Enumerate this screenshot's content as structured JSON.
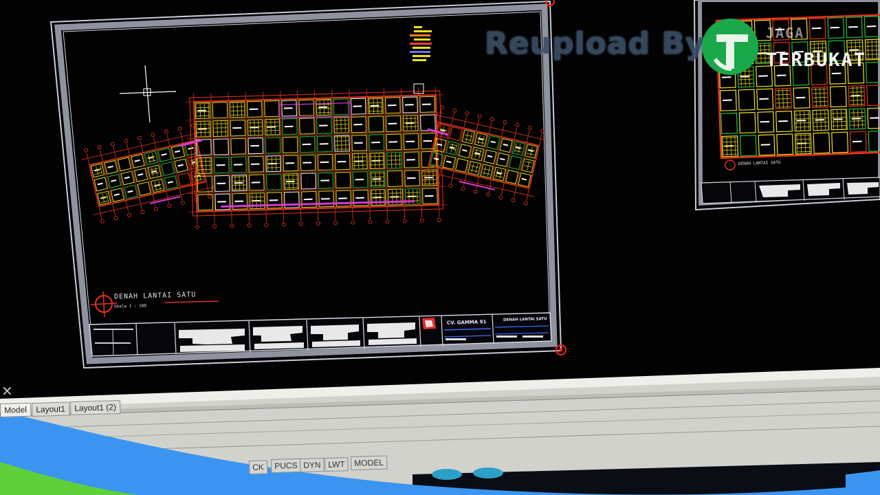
{
  "watermark": {
    "text": "Reupload By",
    "logo_line1": "JAGA",
    "logo_line2": "TERBUKAT",
    "color": "#3a4f66",
    "logo_color": "#1aa84a"
  },
  "drawing": {
    "plan_title": "DENAH LANTAI SATU",
    "plan_scale": "Skala 1 : 100",
    "company": "CV. GAMMA 91",
    "sheet_title": "DENAH LANTAI SATU",
    "second_plan_title": "DENAH LANTAI SATU"
  },
  "window": {
    "close_glyph": "×"
  },
  "layout_tabs": [
    {
      "label": "Model",
      "active": true
    },
    {
      "label": "Layout1",
      "active": false
    },
    {
      "label": "Layout1 (2)",
      "active": false
    }
  ],
  "status_bar": {
    "buttons": [
      "PUCS",
      "DYN",
      "LWT",
      "MODEL"
    ],
    "partial_button": "CK"
  },
  "colors": {
    "background": "#020203",
    "plan_red": "#e8331c",
    "plan_yellow": "#f0e020",
    "plan_green": "#22c040",
    "plan_white": "#ffffff",
    "plan_magenta": "#d23ad2",
    "paper_border": "#b8bcc6",
    "grip_red": "#ff2020",
    "accent_blue": "#3b95f0",
    "accent_green": "#5fcf3a"
  }
}
